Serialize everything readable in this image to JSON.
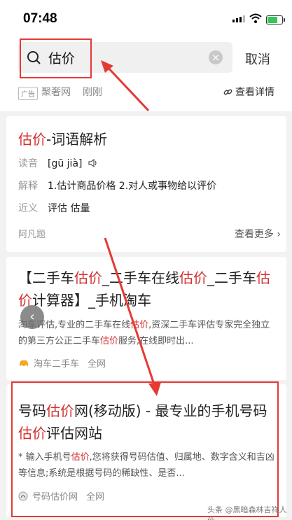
{
  "status": {
    "time": "07:48"
  },
  "search": {
    "query": "估价",
    "cancel_label": "取消"
  },
  "ad": {
    "tag": "广告",
    "source": "聚奢网",
    "time": "刚刚",
    "detail_label": "查看详情"
  },
  "card1": {
    "title_highlight": "估价",
    "title_rest": "-词语解析",
    "rows": [
      {
        "label": "读音",
        "value": "[gū jià]"
      },
      {
        "label": "解释",
        "value": "1.估计商品价格 2.对人或事物给以评价"
      },
      {
        "label": "近义",
        "value": "评估 估量"
      }
    ],
    "source": "阿凡题",
    "more_label": "查看更多"
  },
  "card2": {
    "title_parts": [
      "【二手车",
      "估价",
      "_二手车在线",
      "估价",
      "_二手车",
      "估价",
      "计算器】_手机淘车"
    ],
    "snippet_parts": [
      "淘车评估,专业的二手车在线",
      "估价",
      ",资深二手车评估专家完全独立的第三方公正二手车",
      "估价",
      "服务,在线即时出..."
    ],
    "source": "淘车二手车",
    "scope": "全网"
  },
  "card3": {
    "title_parts": [
      "号码",
      "估价",
      "网(移动版) - 最专业的手机号码",
      "估价",
      "评估网站"
    ],
    "snippet_parts": [
      "* 输入手机号",
      "估价",
      ",您将获得号码估值、归属地、数字含义和吉凶等信息;系统是根据号码的稀缺性、是否..."
    ],
    "source": "号码估价网",
    "scope": "全网"
  },
  "watermark": "头条 @黑暗森林吉祥人仙"
}
